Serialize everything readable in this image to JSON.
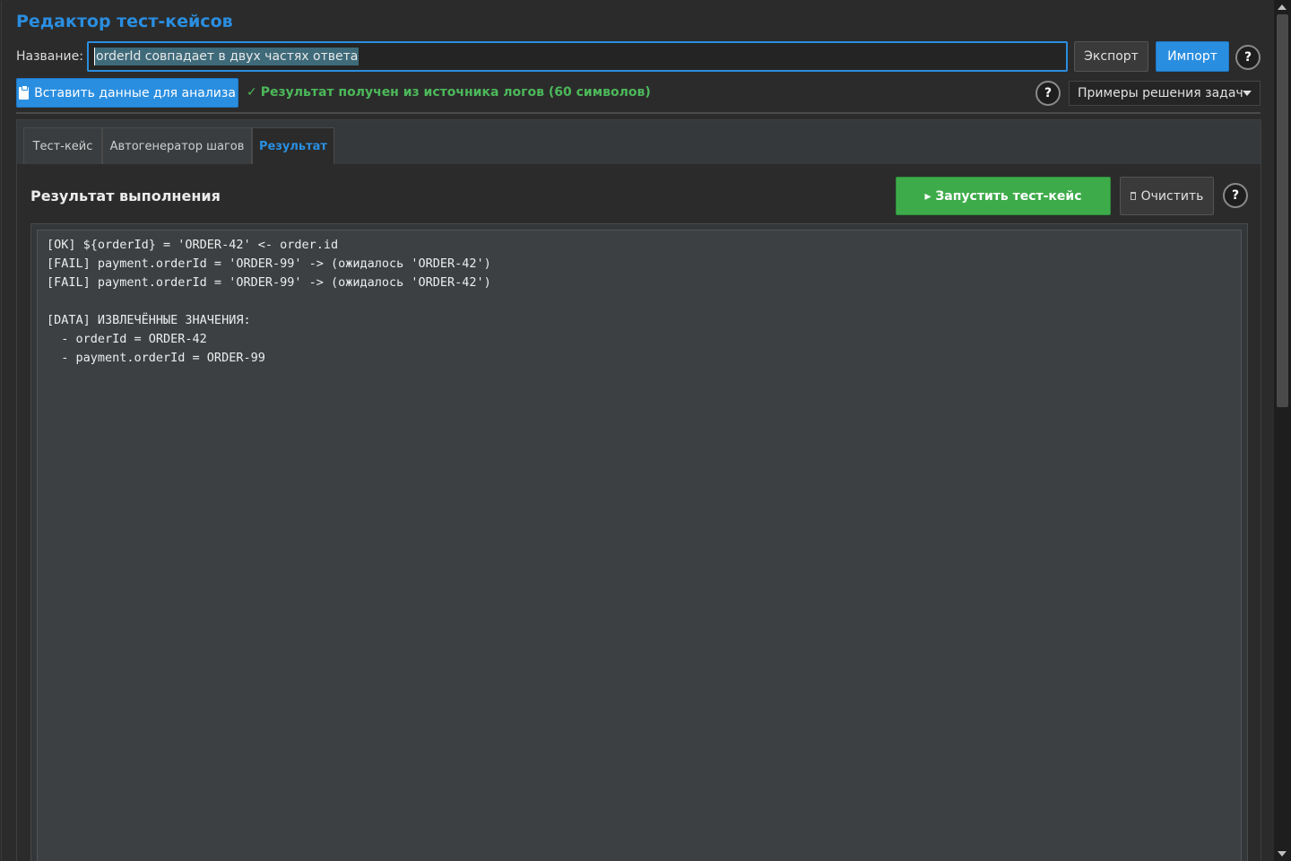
{
  "app": {
    "title": "Редактор тест-кейсов"
  },
  "name_row": {
    "label": "Название:",
    "value": "orderId совпадает в двух частях ответа",
    "export_label": "Экспорт",
    "import_label": "Импорт",
    "help": "?"
  },
  "action_row": {
    "paste_label": "Вставить данные для анализа",
    "status_check": "✓",
    "status_text": "Результат получен из источника логов (60 символов)",
    "help": "?",
    "examples_label": "Примеры решения задач"
  },
  "tabs": [
    {
      "label": "Тест-кейс"
    },
    {
      "label": "Автогенератор шагов"
    },
    {
      "label": "Результат"
    }
  ],
  "result": {
    "title": "Результат выполнения",
    "run_label": "▸ Запустить тест-кейс",
    "clear_label": "Очистить",
    "help": "?",
    "output": "[OK] ${orderId} = 'ORDER-42' <- order.id\n[FAIL] payment.orderId = 'ORDER-99' -> (ожидалось 'ORDER-42')\n[FAIL] payment.orderId = 'ORDER-99' -> (ожидалось 'ORDER-42')\n\n[DATA] ИЗВЛЕЧЁННЫЕ ЗНАЧЕНИЯ:\n  - orderId = ORDER-42\n  - payment.orderId = ORDER-99"
  },
  "colors": {
    "accent": "#2a8ee0",
    "success": "#4cb85a",
    "run_button": "#3eab4a",
    "background": "#2b2b2b"
  }
}
